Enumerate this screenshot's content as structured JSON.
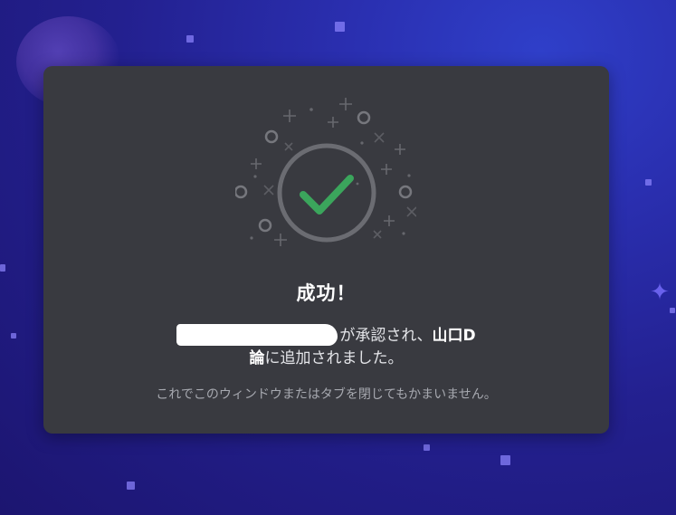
{
  "dialog": {
    "title": "成功！",
    "message_part1": "が承認され、",
    "guild_name_part1": "山口D",
    "guild_name_part2": "論",
    "message_part2": "に追加されました。",
    "note": "これでこのウィンドウまたはタブを閉じてもかまいません。"
  },
  "icons": {
    "success": "check-circle-icon",
    "decoration": "sparkle-icon",
    "background_decoration": "star-icon"
  },
  "colors": {
    "accent_success": "#3ba55c",
    "card_bg": "#393a40",
    "ring": "#6b6c72"
  }
}
